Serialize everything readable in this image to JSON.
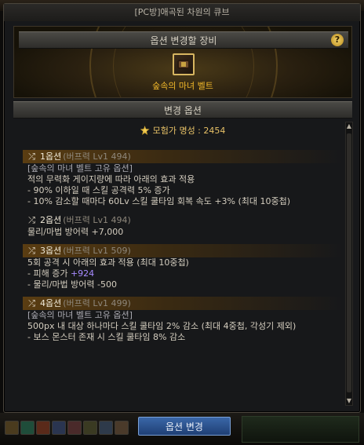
{
  "window": {
    "title": "[PC방]애곡된 차원의 큐브",
    "close_label": ""
  },
  "equip": {
    "section_title": "옵션 변경할 장비",
    "help_label": "?",
    "item_name": "숲속의 마녀 벨트"
  },
  "options_section": {
    "title": "변경 옵션"
  },
  "fame": {
    "label": "모험가 명성 : 2454"
  },
  "options": [
    {
      "label": "1옵션",
      "sub": "(버프력 Lv1 494)",
      "gold": true,
      "lines": [
        {
          "text": "[숲속의 마녀 벨트 고유 옵션]",
          "tag": true
        },
        {
          "text": "적의 무력화 게이지량에 따라 아래의 효과 적용"
        },
        {
          "text": "- 90% 이하일 때 스킬 공격력 5% 증가"
        },
        {
          "text": "- 10% 감소할 때마다 60Lv 스킬 쿨타임 회복 속도 +3% (최대 10중첩)"
        }
      ]
    },
    {
      "label": "2옵션",
      "sub": "(버프력 Lv1 494)",
      "gold": false,
      "lines": [
        {
          "text": "물리/마법 방어력 +7,000"
        }
      ]
    },
    {
      "label": "3옵션",
      "sub": "(버프력 Lv1 509)",
      "gold": true,
      "lines": [
        {
          "text": "5회 공격 시 아래의 효과 적용 (최대 10중첩)"
        },
        {
          "text": "- 피해 증가 ",
          "hl": "+924"
        },
        {
          "text": "- 물리/마법 방어력 -500"
        }
      ]
    },
    {
      "label": "4옵션",
      "sub": "(버프력 Lv1 499)",
      "gold": true,
      "lines": [
        {
          "text": "[숲속의 마녀 벨트 고유 옵션]",
          "tag": true
        },
        {
          "text": "500px 내 대상 하나마다 스킬 쿨타임 2% 감소 (최대 4중첩, 각성기 제외)"
        },
        {
          "text": "- 보스 몬스터 존재 시 스킬 쿨타임 8% 감소"
        }
      ]
    }
  ],
  "actions": {
    "change_button": "옵션 변경"
  },
  "colors": {
    "gold": "#f0b72a",
    "highlight": "#a78bff",
    "button": "#2c55a0"
  }
}
